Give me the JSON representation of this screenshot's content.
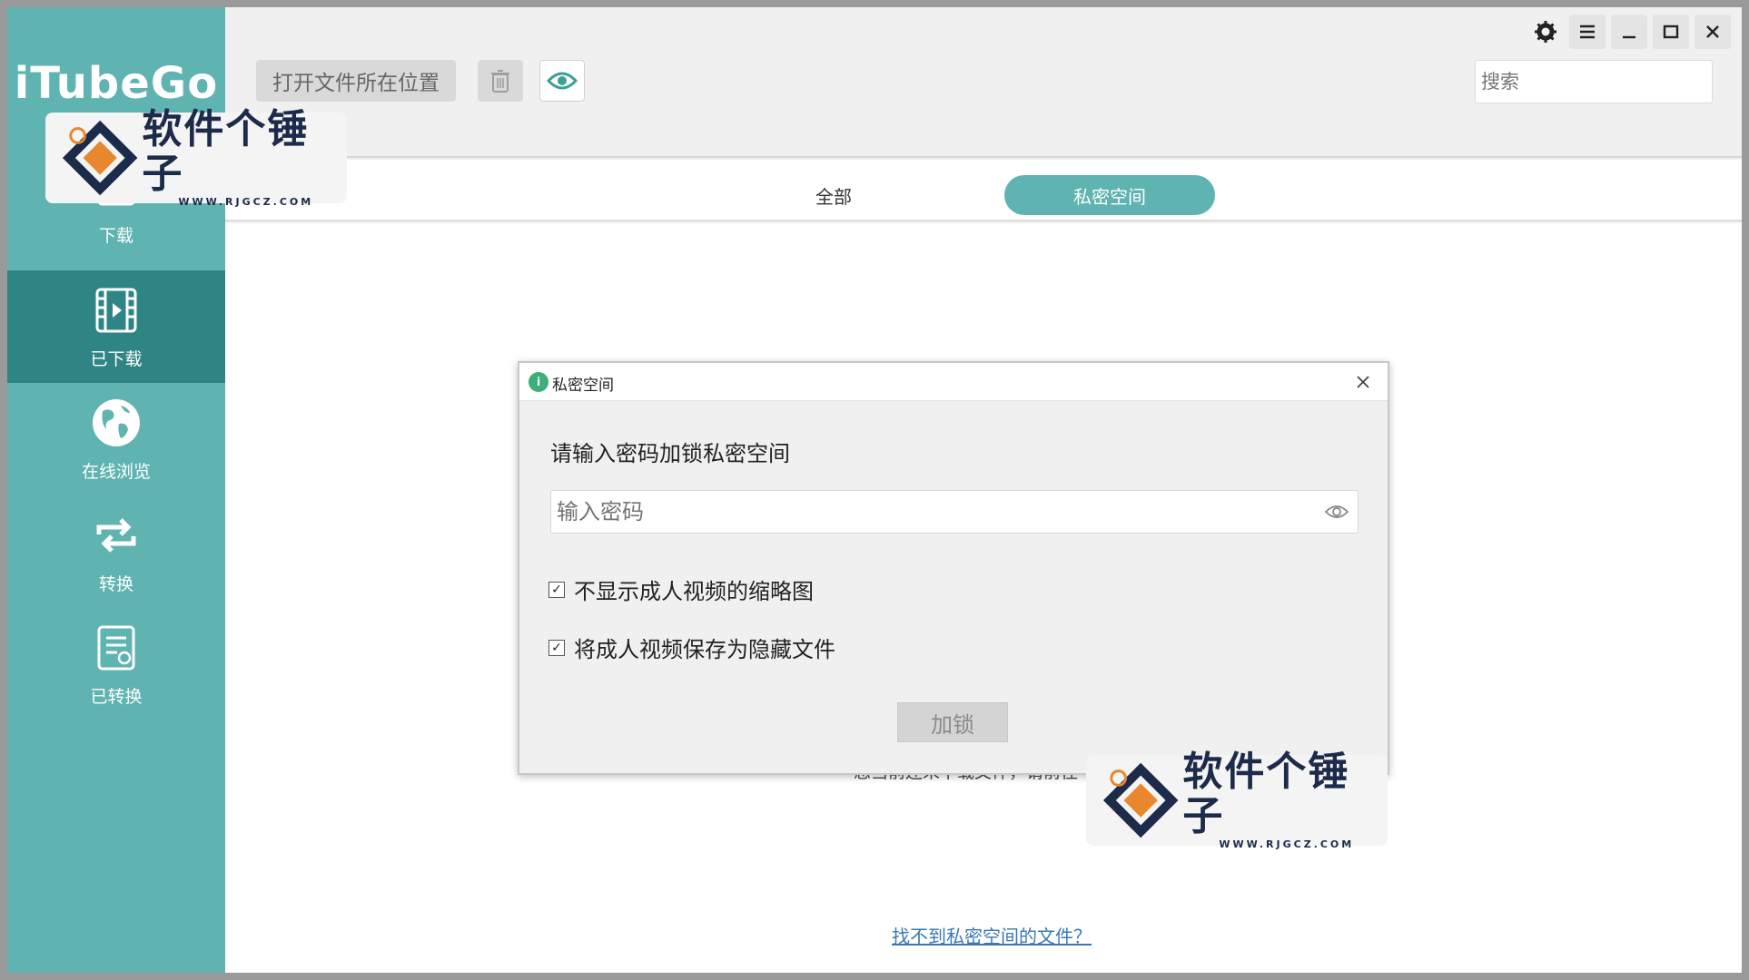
{
  "app": {
    "name": "iTubeGo"
  },
  "sidebar": {
    "items": [
      {
        "label": "下载",
        "icon": "download-icon"
      },
      {
        "label": "已下载",
        "icon": "film-icon",
        "active": true
      },
      {
        "label": "在线浏览",
        "icon": "globe-icon"
      },
      {
        "label": "转换",
        "icon": "convert-icon"
      },
      {
        "label": "已转换",
        "icon": "converted-list-icon"
      }
    ]
  },
  "toolbar": {
    "open_location_label": "打开文件所在位置",
    "trash_icon": "trash-icon",
    "eye_icon": "eye-icon",
    "search_placeholder": "搜索"
  },
  "window_controls": [
    "gear-icon",
    "menu-icon",
    "minimize-icon",
    "maximize-icon",
    "close-icon"
  ],
  "tabs": [
    {
      "label": "全部",
      "active": false
    },
    {
      "label": "私密空间",
      "active": true
    }
  ],
  "content": {
    "empty_text": "您当前还未下载文件，请前往",
    "help_link": "找不到私密空间的文件？"
  },
  "dialog": {
    "title": "私密空间",
    "heading": "请输入密码加锁私密空间",
    "password_placeholder": "输入密码",
    "options": [
      {
        "label": "不显示成人视频的缩略图",
        "checked": true
      },
      {
        "label": "将成人视频保存为隐藏文件",
        "checked": true
      }
    ],
    "lock_button": "加锁"
  },
  "watermark": {
    "text": "软件个锤子",
    "url": "WWW.RJGCZ.COM"
  },
  "colors": {
    "accent": "#5fb3b0",
    "active_nav": "#2f8583",
    "link": "#3a78b5"
  }
}
